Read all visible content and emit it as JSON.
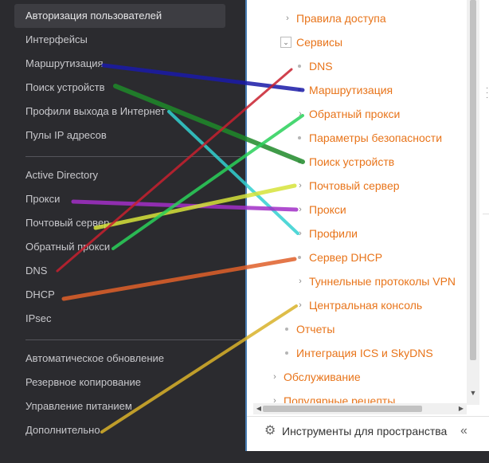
{
  "sidebar": {
    "groups": [
      [
        "Авторизация пользователей",
        "Интерфейсы",
        "Маршрутизация",
        "Поиск устройств",
        "Профили выхода в Интернет",
        "Пулы IP адресов"
      ],
      [
        "Active Directory",
        "Прокси",
        "Почтовый сервер",
        "Обратный прокси",
        "DNS",
        "DHCP",
        "IPsec"
      ],
      [
        "Автоматическое обновление",
        "Резервное копирование",
        "Управление питанием",
        "Дополнительно"
      ]
    ],
    "active": "Авторизация пользователей"
  },
  "tree": {
    "items": [
      {
        "label": "Правила доступа",
        "marker": "arrow"
      },
      {
        "label": "Сервисы",
        "marker": "expanded"
      },
      {
        "label": "DNS",
        "marker": "dot"
      },
      {
        "label": "Маршрутизация",
        "marker": "dot"
      },
      {
        "label": "Обратный прокси",
        "marker": "arrow"
      },
      {
        "label": "Параметры безопасности",
        "marker": "dot"
      },
      {
        "label": "Поиск устройств",
        "marker": "dot"
      },
      {
        "label": "Почтовый сервер",
        "marker": "arrow"
      },
      {
        "label": "Прокси",
        "marker": "arrow"
      },
      {
        "label": "Профили",
        "marker": "arrow"
      },
      {
        "label": "Сервер DHCP",
        "marker": "dot"
      },
      {
        "label": "Туннельные протоколы VPN",
        "marker": "arrow"
      },
      {
        "label": "Центральная консоль",
        "marker": "arrow"
      },
      {
        "label": "Отчеты",
        "marker": "dot"
      },
      {
        "label": "Интеграция ICS и SkyDNS",
        "marker": "dot"
      },
      {
        "label": "Обслуживание",
        "marker": "arrow"
      },
      {
        "label": "Популярные рецепты",
        "marker": "arrow"
      }
    ]
  },
  "bottom": {
    "tools_label": "Инструменты для пространства",
    "gear_icon": "gear-icon",
    "collapse_icon": "double-chevron-left-icon"
  },
  "colors": {
    "accent": "#e8741a",
    "sidebar_bg": "#2b2b2f",
    "sidebar_text": "#c8c8cc"
  },
  "connectors": [
    {
      "from": "Маршрутизация",
      "to": "Маршрутизация",
      "color": "#1a1aa8"
    },
    {
      "from": "Поиск устройств",
      "to": "Поиск устройств",
      "color": "#1f8a2a"
    },
    {
      "from": "Профили выхода в Интернет",
      "to": "Профили",
      "color": "#33d1d1"
    },
    {
      "from": "Прокси",
      "to": "Прокси",
      "color": "#a22fc7"
    },
    {
      "from": "Почтовый сервер",
      "to": "Почтовый сервер",
      "color": "#d6e33a"
    },
    {
      "from": "Обратный прокси",
      "to": "Обратный прокси",
      "color": "#2ad15a"
    },
    {
      "from": "DNS",
      "to": "DNS",
      "color": "#c8202e"
    },
    {
      "from": "DHCP",
      "to": "Сервер DHCP",
      "color": "#e0602a"
    },
    {
      "from": "Дополнительно",
      "to": "Центральная консоль",
      "color": "#d9b22a"
    }
  ]
}
